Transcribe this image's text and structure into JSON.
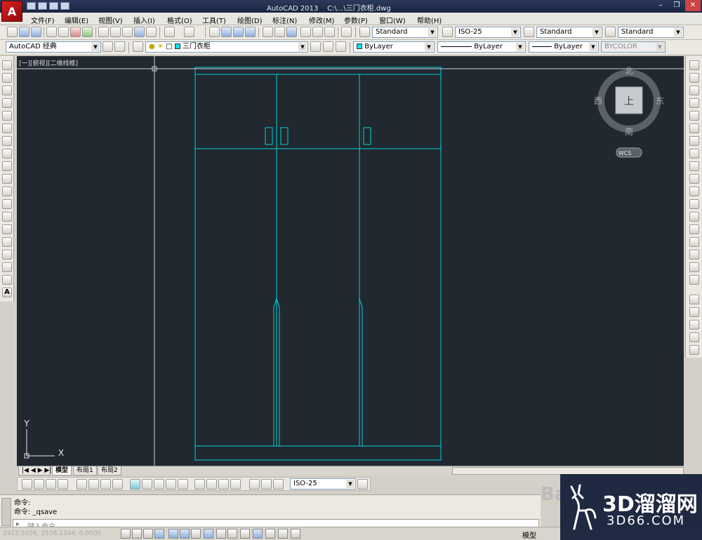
{
  "titlebar": {
    "app_name": "AutoCAD 2013",
    "file_path": "C:\\...\\三门衣柜.dwg",
    "logo_letter": "A"
  },
  "menus": [
    "文件(F)",
    "编辑(E)",
    "视图(V)",
    "插入(I)",
    "格式(O)",
    "工具(T)",
    "绘图(D)",
    "标注(N)",
    "修改(M)",
    "参数(P)",
    "窗口(W)",
    "帮助(H)"
  ],
  "styles": {
    "text_style": "Standard",
    "dim_style": "ISO-25",
    "table_style": "Standard",
    "multileader_style": "Standard"
  },
  "workspace": "AutoCAD 经典",
  "layer": {
    "current": "三门衣柜",
    "color": "#00e5ee"
  },
  "properties": {
    "color": "ByLayer",
    "linetype": "ByLayer",
    "lineweight": "ByLayer",
    "plotstyle": "BYCOLOR"
  },
  "viewport": {
    "label": "[一][俯视][二维线框]",
    "bg_color": "#212830",
    "line_color": "#00d4d8"
  },
  "viewcube": {
    "north": "北",
    "south": "南",
    "east": "东",
    "west": "西",
    "face": "上",
    "wcs": "WCS"
  },
  "ucs": {
    "x": "X",
    "y": "Y"
  },
  "layout_tabs": [
    "模型",
    "布局1",
    "布局2"
  ],
  "dim_toolbar": {
    "dim_style": "ISO-25"
  },
  "command": {
    "history": [
      "命令:",
      "命令:  _qsave"
    ],
    "prompt": "键入命令"
  },
  "status": {
    "coords": "2972.5036, 2538.1344, 0.0000",
    "model": "模型"
  },
  "watermark": {
    "main": "3D溜溜网",
    "sub": "3D66.COM",
    "side": "Ba"
  }
}
